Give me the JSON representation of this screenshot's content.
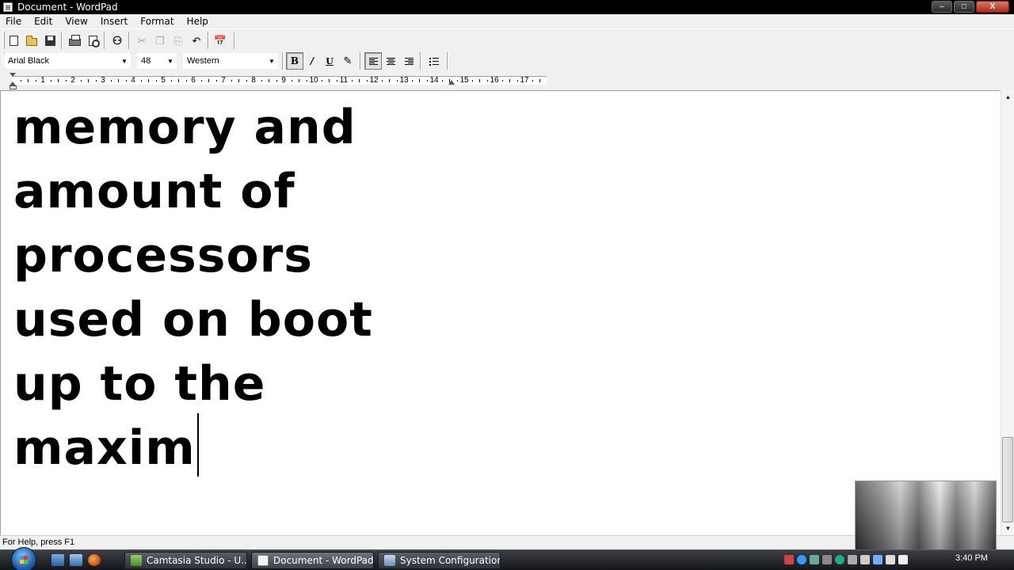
{
  "window": {
    "title": "Document - WordPad",
    "minimize_label": "–",
    "maximize_label": "□",
    "close_label": "X"
  },
  "menu": {
    "items": [
      "File",
      "Edit",
      "View",
      "Insert",
      "Format",
      "Help"
    ]
  },
  "toolbar": {
    "icons": [
      "new-document-icon",
      "open-folder-icon",
      "save-icon",
      "print-icon",
      "print-preview-icon",
      "find-icon",
      "cut-icon",
      "copy-icon",
      "paste-icon",
      "undo-icon",
      "date-time-icon"
    ]
  },
  "format_bar": {
    "font_name": "Arial Black",
    "font_size": "48",
    "script": "Western",
    "bold_label": "B",
    "italic_label": "/",
    "underline_label": "U",
    "bold_pressed": true,
    "align_left_pressed": true,
    "icons": [
      "color-icon",
      "align-left-icon",
      "align-center-icon",
      "align-right-icon",
      "bullets-icon"
    ]
  },
  "ruler": {
    "numbers": [
      "1",
      "2",
      "3",
      "4",
      "5",
      "6",
      "7",
      "8",
      "9",
      "10",
      "11",
      "12",
      "13",
      "14",
      "15",
      "16",
      "17"
    ]
  },
  "document": {
    "lines": [
      "memory and",
      "amount of",
      "processors",
      "used on boot",
      "up to the",
      "maxim"
    ]
  },
  "status": {
    "text": "For Help, press F1"
  },
  "taskbar": {
    "tasks": [
      {
        "label": "Camtasia Studio - U...",
        "active": false
      },
      {
        "label": "Document - WordPad",
        "active": true
      },
      {
        "label": "System Configuration",
        "active": false
      }
    ],
    "clock": "3:40 PM"
  },
  "colors": {
    "titlebar": "#000000",
    "chrome": "#f0f0f0",
    "taskbar": "#22252a"
  }
}
